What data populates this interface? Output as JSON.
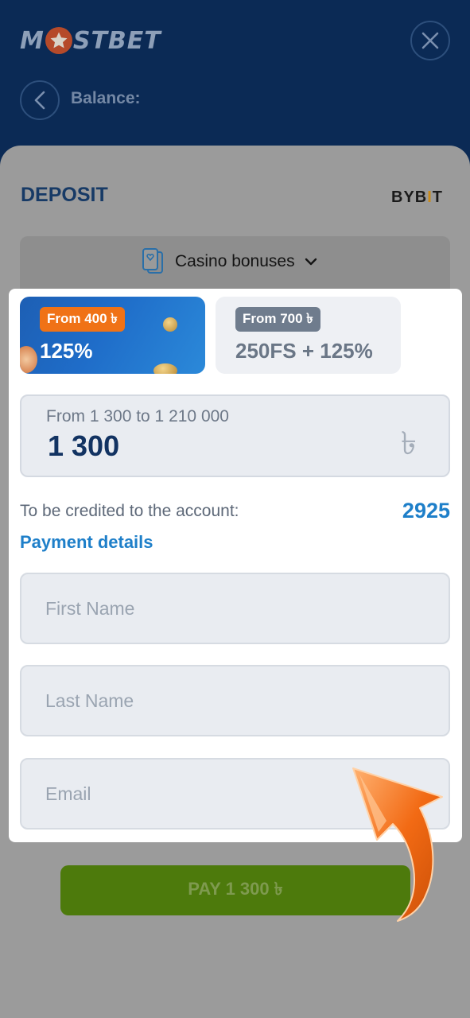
{
  "header": {
    "logo_text_left": "M",
    "logo_text_right": "STBET",
    "balance_label": "Balance:"
  },
  "deposit": {
    "title": "DEPOSIT",
    "provider": {
      "left": "BYB",
      "bar": "I",
      "right": "T"
    },
    "bonus_select_label": "Casino bonuses"
  },
  "bonus_cards": [
    {
      "badge": "From 400 ৳",
      "value": "125%",
      "selected": true
    },
    {
      "badge": "From 700 ৳",
      "value": "250FS + 125%",
      "selected": false
    }
  ],
  "amount": {
    "hint": "From 1 300 to 1 210 000",
    "value": "1 300",
    "currency_symbol": "৳"
  },
  "credited": {
    "label": "To be credited to the account:",
    "value": "2925"
  },
  "payment_details_label": "Payment details",
  "form": {
    "first_name_placeholder": "First Name",
    "last_name_placeholder": "Last Name",
    "email_placeholder": "Email"
  },
  "pay_button_label": "PAY 1 300 ৳",
  "colors": {
    "header_bg": "#0b2a55",
    "accent_blue": "#1e7fc9",
    "badge_orange": "#f07216",
    "pay_green": "#4d7a0c",
    "arrow_orange": "#f26a14"
  },
  "icons": [
    "close-icon",
    "chevron-left-icon",
    "star-icon",
    "cards-icon",
    "chevron-down-icon",
    "arrow-pointer-icon"
  ]
}
